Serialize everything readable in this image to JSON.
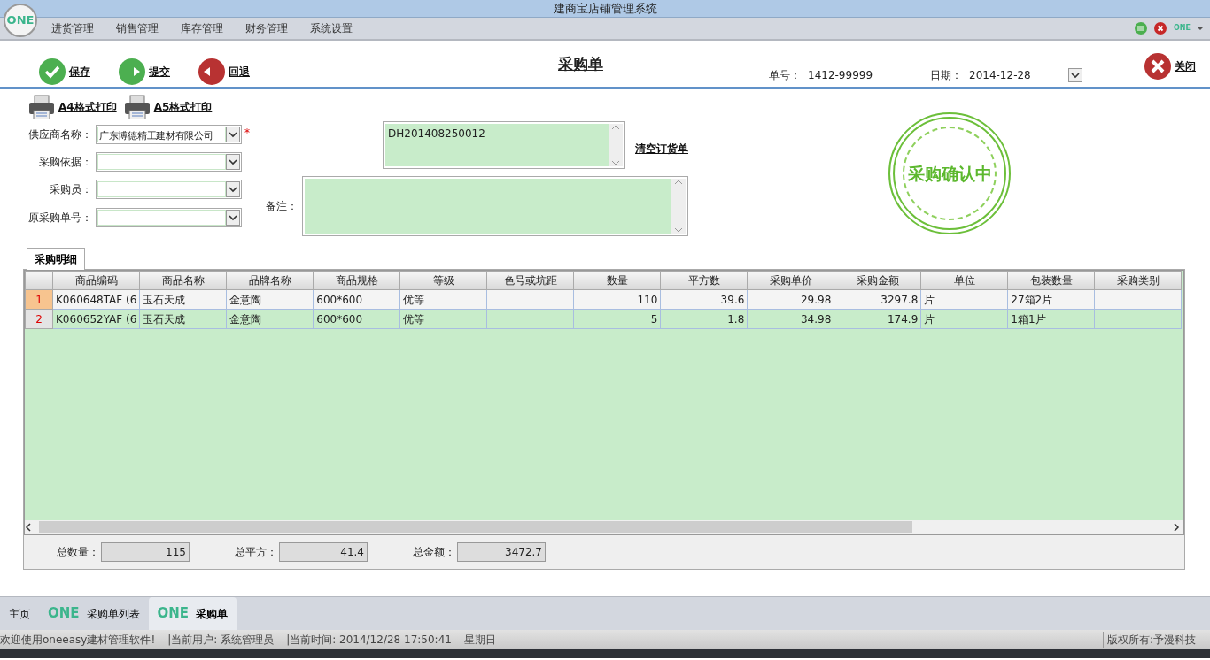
{
  "window": {
    "title": "建商宝店铺管理系统"
  },
  "logo": "ONE",
  "menu": [
    "进货管理",
    "销售管理",
    "库存管理",
    "财务管理",
    "系统设置"
  ],
  "top_right_logo": "ONE",
  "toolbar": {
    "buttons": [
      {
        "label": "保存",
        "kind": "save"
      },
      {
        "label": "提交",
        "kind": "submit"
      },
      {
        "label": "回退",
        "kind": "back"
      }
    ],
    "title": "采购单",
    "order_no_label": "单号：",
    "order_no": "1412-99999",
    "date_label": "日期：",
    "date": "2014-12-28",
    "close": "关闭"
  },
  "print_buttons": [
    "A4格式打印",
    "A5格式打印"
  ],
  "form": {
    "fields": [
      {
        "label": "供应商名称：",
        "value": "广东博德精工建材有限公司",
        "marker": "*"
      },
      {
        "label": "采购依据："
      },
      {
        "label": "采购员："
      },
      {
        "label": "原采购单号："
      }
    ],
    "order_ref": "DH201408250012",
    "clear_link": "清空订货单",
    "remark_label": "备注："
  },
  "stamp": "采购确认中",
  "detail_tab": {
    "label": "采购明细",
    "selected": true
  },
  "table": {
    "columns": [
      "商品编码",
      "商品名称",
      "品牌名称",
      "商品规格",
      "等级",
      "色号或坑距",
      "数量",
      "平方数",
      "采购单价",
      "采购金额",
      "单位",
      "包装数量",
      "采购类别"
    ],
    "rows": [
      {
        "number": "1",
        "selected": true,
        "cells": [
          "K060648TAF (6",
          "玉石天成",
          "金意陶",
          "600*600",
          "优等",
          null,
          "110",
          "39.6",
          "29.98",
          "3297.8",
          "片",
          "27箱2片",
          null
        ]
      },
      {
        "number": "2",
        "selected": false,
        "cells": [
          "K060652YAF (6",
          "玉石天成",
          "金意陶",
          "600*600",
          "优等",
          null,
          "5",
          "1.8",
          "34.98",
          "174.9",
          "片",
          "1箱1片",
          null
        ]
      }
    ]
  },
  "totals": [
    {
      "label": "总数量：",
      "value": "115"
    },
    {
      "label": "总平方：",
      "value": "41.4"
    },
    {
      "label": "总金额：",
      "value": "3472.7"
    }
  ],
  "bottom_tabs": [
    {
      "label": "主页",
      "selected": false
    },
    {
      "label": "采购单列表",
      "logo": "ONE",
      "selected": false
    },
    {
      "label": "采购单",
      "logo": "ONE",
      "selected": true
    }
  ],
  "status": [
    "欢迎使用oneeasy建材管理软件!",
    "|当前用户: 系统管理员",
    "|当前时间: 2014/12/28 17:50:41",
    "星期日"
  ],
  "copyright": "版权所有:予漫科技"
}
